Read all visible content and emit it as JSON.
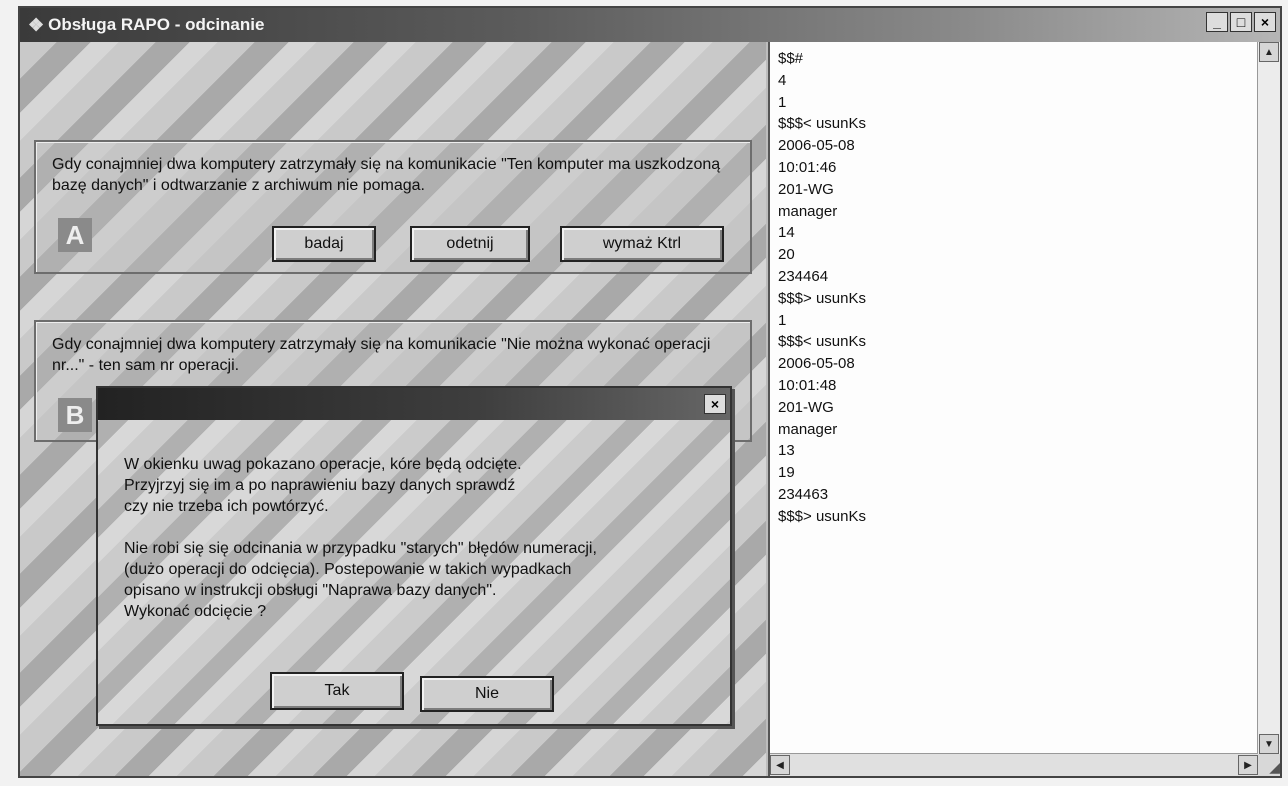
{
  "window": {
    "title": "Obsługa RAPO - odcinanie",
    "minimize_label": "_",
    "maximize_label": "□",
    "close_label": "×"
  },
  "panel_a": {
    "text": "Gdy conajmniej dwa komputery zatrzymały się na komunikacie \"Ten komputer ma uszkodzoną bazę danych\" i odtwarzanie z archiwum nie pomaga.",
    "badge": "A",
    "buttons": [
      "badaj",
      "odetnij",
      "wymaż Ktrl"
    ]
  },
  "panel_b": {
    "text": "Gdy conajmniej dwa komputery zatrzymały się na komunikacie \"Nie można wykonać operacji nr...\" - ten sam nr operacji.",
    "badge": "B"
  },
  "dialog": {
    "close_label": "×",
    "message": "W okienku uwag pokazano operacje, kóre będą odcięte.\nPrzyjrzyj się im a po naprawieniu bazy danych sprawdź\nczy nie trzeba ich powtórzyć.\n\nNie robi się się odcinania w przypadku \"starych\" błędów numeracji,\n(dużo operacji do odcięcia). Postepowanie w takich wypadkach\nopisano w instrukcji obsługi \"Naprawa bazy danych\".\nWykonać odcięcie ?",
    "yes_label": "Tak",
    "no_label": "Nie"
  },
  "log": {
    "lines": [
      "$$#",
      "4",
      "1",
      "$$$< usunKs",
      "2006-05-08",
      "10:01:46",
      "201-WG",
      "manager",
      "14",
      "20",
      "234464",
      "$$$> usunKs",
      "1",
      "$$$< usunKs",
      "2006-05-08",
      "10:01:48",
      "201-WG",
      "manager",
      "13",
      "19",
      "234463",
      "$$$> usunKs"
    ]
  },
  "icons": {
    "app": "app-icon",
    "scroll_up": "arrow-up-icon",
    "scroll_down": "arrow-down-icon",
    "scroll_left": "arrow-left-icon",
    "scroll_right": "arrow-right-icon"
  }
}
